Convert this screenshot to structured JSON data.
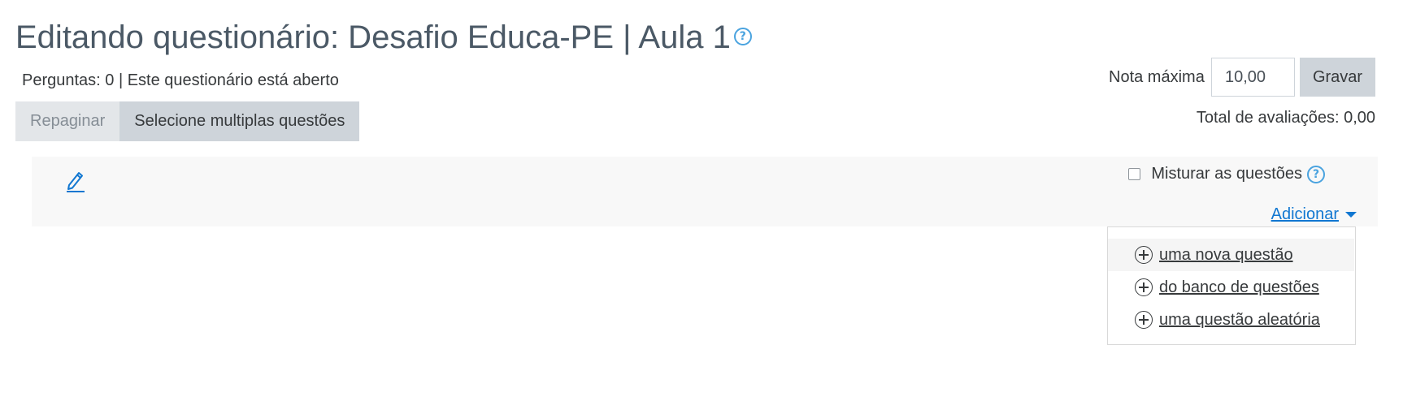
{
  "header": {
    "title": "Editando questionário: Desafio Educa-PE | Aula 1",
    "help_glyph": "?",
    "status": "Perguntas: 0 | Este questionário está aberto"
  },
  "toolbar": {
    "repaginate_label": "Repaginar",
    "select_multiple_label": "Selecione multiplas questões"
  },
  "grading": {
    "max_grade_label": "Nota máxima",
    "max_grade_value": "10,00",
    "save_label": "Gravar",
    "total_label": "Total de avaliações: 0,00"
  },
  "section": {
    "shuffle_label": "Misturar as questões",
    "shuffle_checked": false,
    "add_label": "Adicionar"
  },
  "add_menu": {
    "items": [
      {
        "label": " uma nova questão",
        "icon": "plus-circle-icon"
      },
      {
        "label": " do banco de questões",
        "icon": "plus-circle-icon"
      },
      {
        "label": " uma questão aleatória",
        "icon": "plus-circle-icon"
      }
    ]
  },
  "colors": {
    "title": "#4b5966",
    "link": "#1177d1",
    "help": "#4aa3df",
    "button": "#ced4da"
  }
}
